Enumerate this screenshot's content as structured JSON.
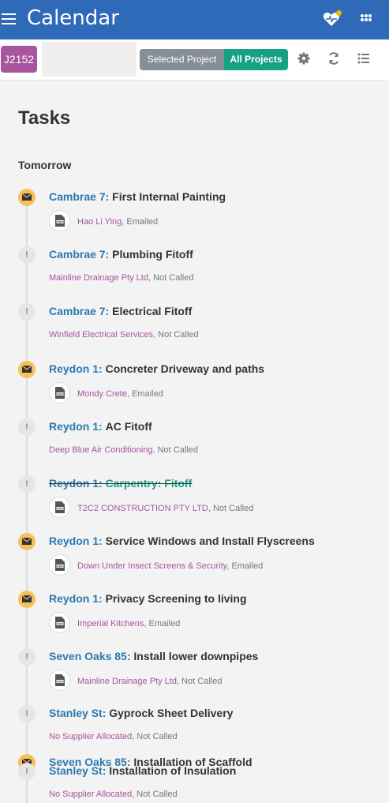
{
  "header": {
    "title": "Calendar"
  },
  "projectbar": {
    "job_code": "J2152",
    "selected_project_label": "Selected Project",
    "all_projects_label": "All Projects"
  },
  "page": {
    "title": "Tasks",
    "section": "Tomorrow"
  },
  "colors": {
    "header": "#2e6ab8",
    "job_badge": "#a8549f",
    "all_projects": "#17a085",
    "project_link": "#2a79b0",
    "supplier": "#a8549f",
    "mail_marker": "#f7c05c"
  },
  "tasks": [
    {
      "project": "Cambrae 7:",
      "name": "First Internal Painting",
      "supplier": "Hao Li Ying",
      "status": ", Emailed",
      "marker": "mail-icon",
      "pdf": true,
      "done": false
    },
    {
      "project": "Cambrae 7:",
      "name": "Plumbing Fitoff",
      "supplier": "Mainline Drainage Pty Ltd",
      "status": ", Not Called",
      "marker": "alert-icon",
      "pdf": false,
      "done": false
    },
    {
      "project": "Cambrae 7:",
      "name": "Electrical Fitoff",
      "supplier": "Winfield Electrical Services",
      "status": ", Not Called",
      "marker": "alert-icon",
      "pdf": false,
      "done": false
    },
    {
      "project": "Reydon 1:",
      "name": "Concreter Driveway and paths",
      "supplier": "Mondy Crete",
      "status": ", Emailed",
      "marker": "mail-icon",
      "pdf": true,
      "done": false
    },
    {
      "project": "Reydon 1:",
      "name": "AC Fitoff",
      "supplier": "Deep Blue Air Conditioning",
      "status": ", Not Called",
      "marker": "alert-icon",
      "pdf": false,
      "done": false
    },
    {
      "project": "Reydon 1:",
      "name": "Carpentry: Fitoff",
      "supplier": "T2C2 CONSTRUCTION PTY LTD",
      "status": ", Not Called",
      "marker": "alert-icon",
      "pdf": true,
      "done": true
    },
    {
      "project": "Reydon 1:",
      "name": "Service Windows and Install Flyscreens",
      "supplier": "Down Under Insect Screens & Security",
      "status": ", Emailed",
      "marker": "mail-icon",
      "pdf": true,
      "done": false
    },
    {
      "project": "Reydon 1:",
      "name": "Privacy Screening to living",
      "supplier": "Imperial Kitchens",
      "status": ", Emailed",
      "marker": "mail-icon",
      "pdf": true,
      "done": false
    },
    {
      "project": "Seven Oaks 85:",
      "name": "Install lower downpipes",
      "supplier": "Mainline Drainage Pty Ltd",
      "status": ", Not Called",
      "marker": "alert-icon",
      "pdf": true,
      "done": false
    },
    {
      "project": "Stanley St:",
      "name": "Gyprock Sheet Delivery",
      "supplier": "No Supplier Allocated",
      "status": ", Not Called",
      "marker": "alert-icon",
      "pdf": false,
      "done": false
    },
    {
      "project": "Seven Oaks 85:",
      "name": "Installation of Scaffold",
      "supplier": "",
      "status": "",
      "marker": "mail-icon",
      "pdf": false,
      "done": false
    },
    {
      "project": "Stanley St:",
      "name": "Installation of Insulation",
      "supplier": "No Supplier Allocated",
      "status": ", Not Called",
      "marker": "alert-icon",
      "pdf": false,
      "done": false
    }
  ]
}
